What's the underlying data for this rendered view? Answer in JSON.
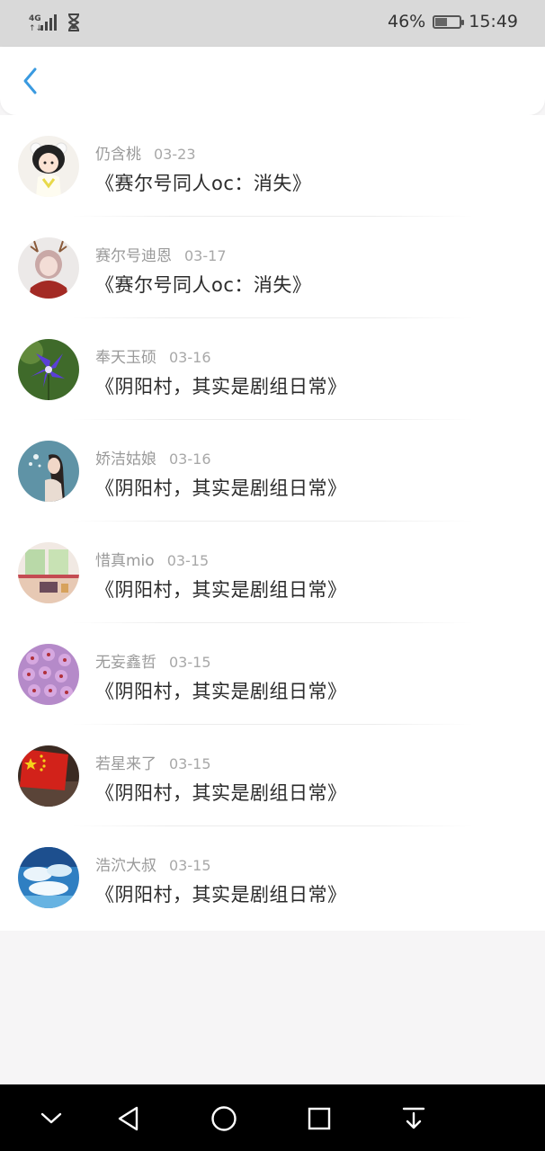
{
  "status_bar": {
    "network": "4G",
    "battery_percent": "46%",
    "battery_level": 0.46,
    "time": "15:49"
  },
  "header": {
    "back_icon": "chevron-left-icon",
    "accent_color": "#3a9ae0"
  },
  "items": [
    {
      "name": "仍含桃",
      "date": "03-23",
      "title": "《赛尔号同人oc：消失》",
      "avatar": "girl-bear-hat"
    },
    {
      "name": "赛尔号迪恩",
      "date": "03-17",
      "title": "《赛尔号同人oc：消失》",
      "avatar": "girl-antlers"
    },
    {
      "name": "奉天玉硕",
      "date": "03-16",
      "title": "《阴阳村，其实是剧组日常》",
      "avatar": "purple-flower"
    },
    {
      "name": "娇洁姑娘",
      "date": "03-16",
      "title": "《阴阳村，其实是剧组日常》",
      "avatar": "girl-dandelion"
    },
    {
      "name": "惜真mio",
      "date": "03-15",
      "title": "《阴阳村，其实是剧组日常》",
      "avatar": "window-room"
    },
    {
      "name": "无妄鑫哲",
      "date": "03-15",
      "title": "《阴阳村，其实是剧组日常》",
      "avatar": "pink-flowers"
    },
    {
      "name": "若星来了",
      "date": "03-15",
      "title": "《阴阳村，其实是剧组日常》",
      "avatar": "red-flag"
    },
    {
      "name": "浩泬大叔",
      "date": "03-15",
      "title": "《阴阳村，其实是剧组日常》",
      "avatar": "sky-clouds"
    }
  ],
  "navbar": [
    "chevron-down-icon",
    "back-triangle-icon",
    "home-circle-icon",
    "recents-square-icon",
    "notification-pull-icon"
  ]
}
